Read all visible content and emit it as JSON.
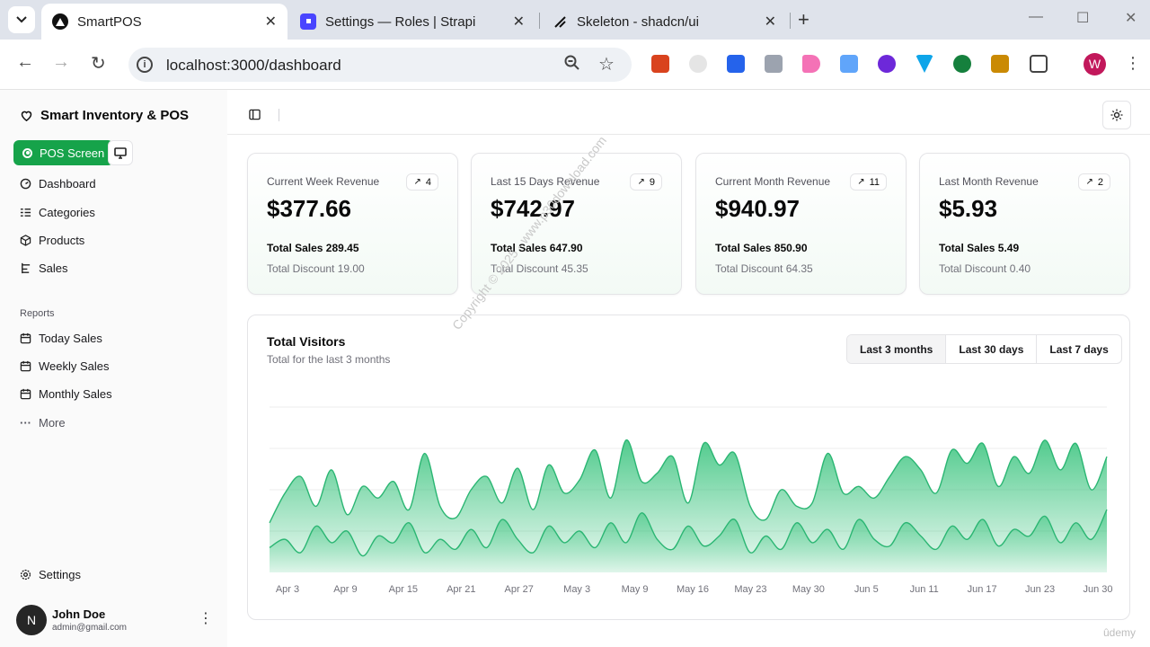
{
  "browser": {
    "tabs": [
      {
        "title": "SmartPOS",
        "active": true,
        "favicon": "triangle-logo-icon"
      },
      {
        "title": "Settings — Roles | Strapi",
        "active": false,
        "favicon": "strapi-logo-icon"
      },
      {
        "title": "Skeleton - shadcn/ui",
        "active": false,
        "favicon": "shadcn-logo-icon"
      }
    ],
    "url": "localhost:3000/dashboard",
    "profile_initial": "W"
  },
  "sidebar": {
    "brand": "Smart Inventory & POS",
    "pos_button": "POS Screen",
    "items": [
      {
        "label": "Dashboard",
        "icon": "dashboard-icon"
      },
      {
        "label": "Categories",
        "icon": "list-icon"
      },
      {
        "label": "Products",
        "icon": "box-icon"
      },
      {
        "label": "Sales",
        "icon": "receipt-icon"
      }
    ],
    "reports_label": "Reports",
    "reports": [
      {
        "label": "Today Sales",
        "icon": "calendar-icon"
      },
      {
        "label": "Weekly Sales",
        "icon": "calendar-icon"
      },
      {
        "label": "Monthly Sales",
        "icon": "calendar-icon"
      },
      {
        "label": "More",
        "icon": "ellipsis-icon"
      }
    ],
    "settings": "Settings",
    "user": {
      "initial": "N",
      "name": "John Doe",
      "email": "admin@gmail.com"
    }
  },
  "cards": [
    {
      "title": "Current Week Revenue",
      "value": "$377.66",
      "badge": "4",
      "sales": "Total Sales 289.45",
      "discount": "Total Discount 19.00"
    },
    {
      "title": "Last 15 Days Revenue",
      "value": "$742.97",
      "badge": "9",
      "sales": "Total Sales 647.90",
      "discount": "Total Discount 45.35"
    },
    {
      "title": "Current Month Revenue",
      "value": "$940.97",
      "badge": "11",
      "sales": "Total Sales 850.90",
      "discount": "Total Discount 64.35"
    },
    {
      "title": "Last Month Revenue",
      "value": "$5.93",
      "badge": "2",
      "sales": "Total Sales 5.49",
      "discount": "Total Discount 0.40"
    }
  ],
  "visitors": {
    "title": "Total Visitors",
    "subtitle": "Total for the last 3 months",
    "ranges": [
      "Last 3 months",
      "Last 30 days",
      "Last 7 days"
    ],
    "selected_range": "Last 3 months"
  },
  "chart_data": {
    "type": "area",
    "title": "Total Visitors",
    "x_tick_labels": [
      "Apr 3",
      "Apr 9",
      "Apr 15",
      "Apr 21",
      "Apr 27",
      "May 3",
      "May 9",
      "May 16",
      "May 23",
      "May 30",
      "Jun 5",
      "Jun 11",
      "Jun 17",
      "Jun 23",
      "Jun 30"
    ],
    "ylim": [
      0,
      1
    ],
    "grid": true,
    "series": [
      {
        "values": [
          0.3,
          0.48,
          0.58,
          0.4,
          0.62,
          0.35,
          0.52,
          0.45,
          0.55,
          0.38,
          0.72,
          0.4,
          0.33,
          0.5,
          0.58,
          0.42,
          0.63,
          0.38,
          0.65,
          0.48,
          0.56,
          0.74,
          0.45,
          0.8,
          0.55,
          0.6,
          0.7,
          0.42,
          0.78,
          0.65,
          0.72,
          0.4,
          0.32,
          0.5,
          0.4,
          0.42,
          0.72,
          0.48,
          0.52,
          0.45,
          0.58,
          0.7,
          0.62,
          0.48,
          0.74,
          0.66,
          0.78,
          0.52,
          0.7,
          0.6,
          0.8,
          0.62,
          0.78,
          0.5,
          0.7
        ]
      },
      {
        "values": [
          0.15,
          0.2,
          0.12,
          0.28,
          0.18,
          0.25,
          0.1,
          0.22,
          0.18,
          0.3,
          0.12,
          0.2,
          0.14,
          0.26,
          0.15,
          0.32,
          0.2,
          0.12,
          0.28,
          0.18,
          0.25,
          0.15,
          0.3,
          0.18,
          0.36,
          0.2,
          0.14,
          0.28,
          0.16,
          0.22,
          0.32,
          0.12,
          0.22,
          0.14,
          0.3,
          0.18,
          0.26,
          0.14,
          0.32,
          0.2,
          0.16,
          0.3,
          0.22,
          0.14,
          0.28,
          0.2,
          0.32,
          0.16,
          0.26,
          0.22,
          0.34,
          0.18,
          0.3,
          0.2,
          0.38
        ]
      }
    ]
  },
  "colors": {
    "accent": "#16a34a",
    "chart_fill": "#34c27a",
    "chart_line": "#2bb673"
  },
  "theme_toggle_icon": "sun-icon"
}
